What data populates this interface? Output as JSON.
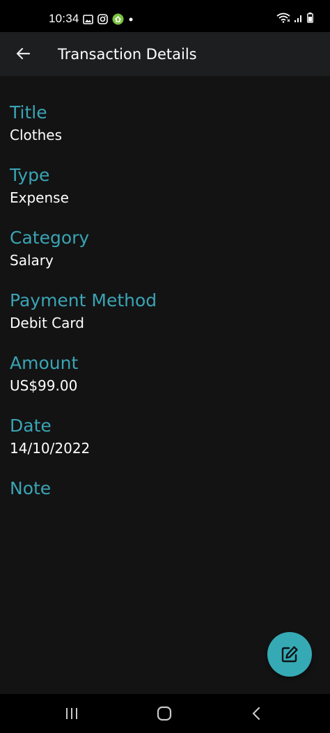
{
  "status_bar": {
    "time": "10:34"
  },
  "app_bar": {
    "title": "Transaction Details"
  },
  "fields": [
    {
      "label": "Title",
      "value": "Clothes"
    },
    {
      "label": "Type",
      "value": "Expense"
    },
    {
      "label": "Category",
      "value": "Salary"
    },
    {
      "label": "Payment Method",
      "value": "Debit Card"
    },
    {
      "label": "Amount",
      "value": "US$99.00"
    },
    {
      "label": "Date",
      "value": "14/10/2022"
    },
    {
      "label": "Note",
      "value": ""
    }
  ],
  "icons": {
    "back": "arrow-back-icon",
    "edit": "edit-icon",
    "nav_recents": "recents-icon",
    "nav_home": "home-icon",
    "nav_back": "chevron-left-icon"
  },
  "colors": {
    "background": "#131314",
    "app_bar": "#1d1e20",
    "label": "#3aa4b4",
    "fab": "#35aab5"
  }
}
